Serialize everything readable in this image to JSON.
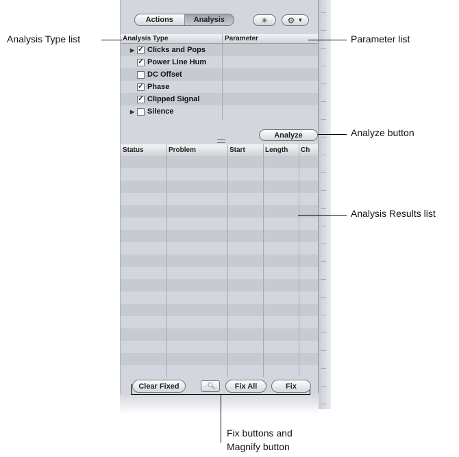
{
  "segmented": {
    "actions": "Actions",
    "analysis": "Analysis"
  },
  "icons": {
    "star": "asterisk-icon",
    "gear": "gear-icon",
    "caret": "chevron-down-icon",
    "magnify": "magnify-icon"
  },
  "analysis_list": {
    "col_type": "Analysis Type",
    "col_param": "Parameter",
    "items": [
      {
        "label": "Clicks and Pops",
        "checked": true,
        "expandable": true
      },
      {
        "label": "Power Line Hum",
        "checked": true,
        "expandable": false
      },
      {
        "label": "DC Offset",
        "checked": false,
        "expandable": false
      },
      {
        "label": "Phase",
        "checked": true,
        "expandable": false
      },
      {
        "label": "Clipped Signal",
        "checked": true,
        "expandable": false
      },
      {
        "label": "Silence",
        "checked": false,
        "expandable": true
      }
    ]
  },
  "analyze_button": "Analyze",
  "results": {
    "columns": [
      "Status",
      "Problem",
      "Start",
      "Length",
      "Ch"
    ]
  },
  "bottom": {
    "clear_fixed": "Clear Fixed",
    "fix_all": "Fix All",
    "fix": "Fix"
  },
  "callouts": {
    "analysis_type_list": "Analysis Type list",
    "parameter_list": "Parameter list",
    "analyze_button": "Analyze button",
    "analysis_results_list": "Analysis Results list",
    "fix_buttons_line1": "Fix buttons and",
    "fix_buttons_line2": "Magnify button"
  },
  "colors": {
    "panel": "#d3d6dd",
    "row_alt": "#c6cad1"
  }
}
